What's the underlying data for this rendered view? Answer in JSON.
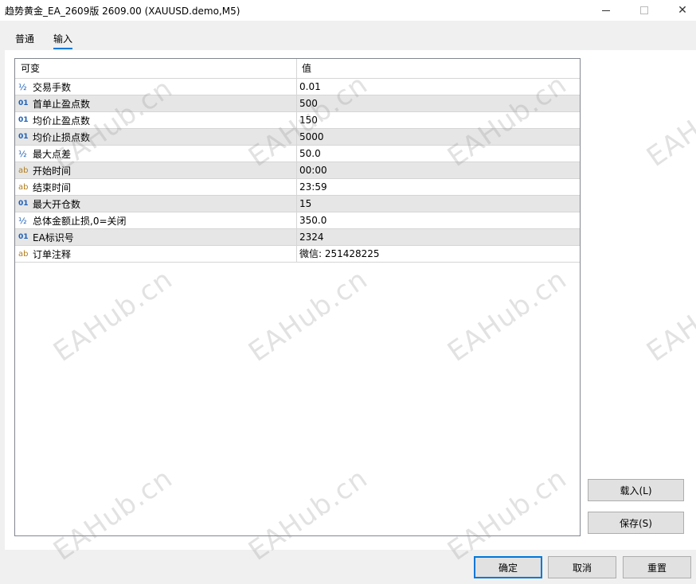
{
  "window": {
    "title": "趋势黄金_EA_2609版 2609.00 (XAUUSD.demo,M5)",
    "minimize_glyph": "—",
    "close_glyph": "✕"
  },
  "tabs": [
    {
      "label": "普通"
    },
    {
      "label": "输入"
    }
  ],
  "grid": {
    "headers": {
      "variable": "可变",
      "value": "值"
    },
    "type_glyphs": {
      "int": "01",
      "double": "½",
      "string": "ab"
    },
    "rows": [
      {
        "type": "double",
        "name": "交易手数",
        "value": "0.01"
      },
      {
        "type": "int",
        "name": "首单止盈点数",
        "value": "500"
      },
      {
        "type": "int",
        "name": "均价止盈点数",
        "value": "150"
      },
      {
        "type": "int",
        "name": "均价止损点数",
        "value": "5000"
      },
      {
        "type": "double",
        "name": "最大点差",
        "value": "50.0"
      },
      {
        "type": "string",
        "name": "开始时间",
        "value": "00:00"
      },
      {
        "type": "string",
        "name": "结束时间",
        "value": "23:59"
      },
      {
        "type": "int",
        "name": "最大开仓数",
        "value": "15"
      },
      {
        "type": "double",
        "name": "总体金额止损,0=关闭",
        "value": "350.0"
      },
      {
        "type": "int",
        "name": "EA标识号",
        "value": "2324"
      },
      {
        "type": "string",
        "name": "订单注释",
        "value": "微信: 251428225"
      }
    ]
  },
  "buttons": {
    "load": "载入(L)",
    "save": "保存(S)",
    "ok": "确定",
    "cancel": "取消",
    "reset": "重置"
  },
  "watermark": "EAHub.cn"
}
